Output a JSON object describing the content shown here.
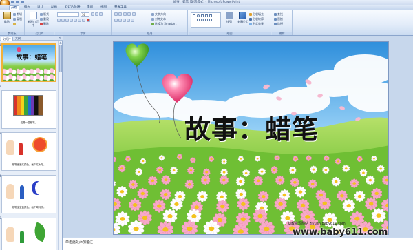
{
  "window": {
    "title": "故事：蜡笔 [兼容模式] - Microsoft PowerPoint"
  },
  "ribbon_tabs": [
    "开始",
    "插入",
    "设计",
    "动画",
    "幻灯片放映",
    "审阅",
    "视图",
    "开发工具"
  ],
  "ribbon": {
    "clipboard": {
      "paste": "粘贴",
      "cut": "剪切",
      "copy": "复制",
      "format_painter": "格式刷",
      "label": "剪贴板"
    },
    "slides": {
      "new_slide": "新建幻灯片",
      "layout": "版式",
      "reset": "重设",
      "delete": "删除",
      "label": "幻灯片"
    },
    "font": {
      "font_name": "",
      "font_size": "36",
      "label": "字体"
    },
    "paragraph": {
      "text_direction": "文字方向",
      "align_text": "对齐文本",
      "smartart": "转换为 SmartArt",
      "label": "段落"
    },
    "drawing": {
      "arrange": "排列",
      "quick_styles": "快速样式",
      "shape_fill": "形状填充",
      "shape_outline": "形状轮廓",
      "shape_effects": "形状效果",
      "label": "绘图"
    },
    "editing": {
      "find": "查找",
      "replace": "替换",
      "select": "选择",
      "label": "编辑"
    }
  },
  "panel": {
    "tabs": [
      "幻灯片",
      "大纲"
    ],
    "close": "×"
  },
  "thumbnails": [
    {
      "num": "1",
      "title": "故事：蜡笔"
    },
    {
      "num": "2",
      "caption": "这是一盒蜡笔。"
    },
    {
      "num": "3",
      "caption": "蜡笔宝宝红颜色，画个红太阳。"
    },
    {
      "num": "4",
      "caption": "蜡笔宝宝蓝颜色，画个弯月亮。"
    },
    {
      "num": "5",
      "caption": ""
    }
  ],
  "slide": {
    "title": "故事：蜡笔",
    "credit": "幼教资源网站 ziyuan.baby611.com",
    "watermark": "www.baby611.com"
  },
  "notes": {
    "placeholder": "单击此处添加备注"
  },
  "colors": {
    "ribbon": "#dfe9f7",
    "selection": "#f1b13b",
    "sky": "#3d9be0",
    "grass": "#6fc23a"
  }
}
